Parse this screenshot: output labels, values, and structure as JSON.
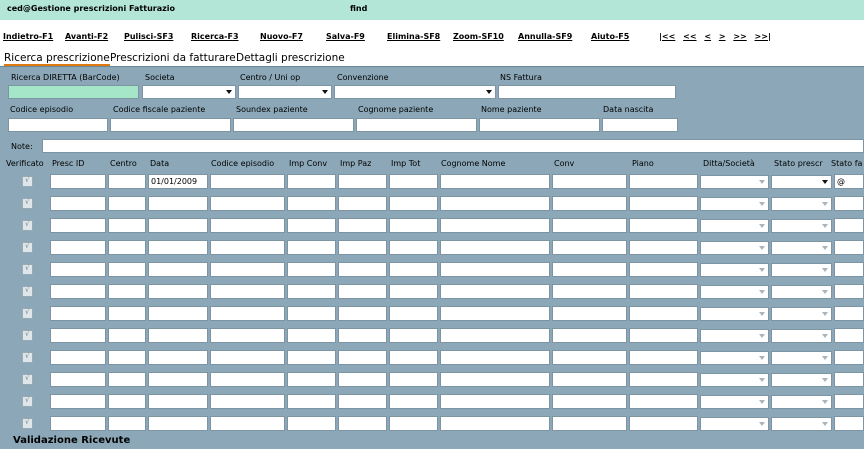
{
  "window": {
    "title": "ced@Gestione prescrizioni Fatturazio",
    "find_label": "find"
  },
  "toolbar": {
    "buttons": [
      "Indietro-F1",
      "Avanti-F2",
      "Pulisci-SF3",
      "Ricerca-F3",
      "Nuovo-F7",
      "Salva-F9",
      "Elimina-SF8",
      "Zoom-SF10",
      "Annulla-SF9",
      "Aiuto-F5"
    ],
    "nav": [
      "|<<",
      "<<",
      "<",
      ">",
      ">>",
      ">>|"
    ]
  },
  "tabs": [
    "Ricerca prescrizione",
    "Prescrizioni da fatturare",
    "Dettagli prescrizione"
  ],
  "search": {
    "labels": {
      "barcode": "Ricerca DIRETTA (BarCode)",
      "societa": "Societa",
      "centro": "Centro / Uni op",
      "convenzione": "Convenzione",
      "ns_fattura": "NS Fattura",
      "codice_episodio": "Codice episodio",
      "codice_fiscale": "Codice fiscale paziente",
      "soundex": "Soundex paziente",
      "cognome": "Cognome paziente",
      "nome": "Nome paziente",
      "data_nascita": "Data nascita",
      "note": "Note:"
    }
  },
  "grid": {
    "columns": [
      "Verificato",
      "Presc ID",
      "Centro",
      "Data",
      "Codice episodio",
      "Imp Conv",
      "Imp Paz",
      "Imp Tot",
      "Cognome Nome",
      "Conv",
      "Piano",
      "Ditta/Società",
      "Stato prescr",
      "Stato fa"
    ],
    "first_row_date": "01/01/2009",
    "first_row_stato_fa": "@",
    "row_count": 12
  },
  "sections": {
    "validazione": "Validazione Ricevute"
  }
}
